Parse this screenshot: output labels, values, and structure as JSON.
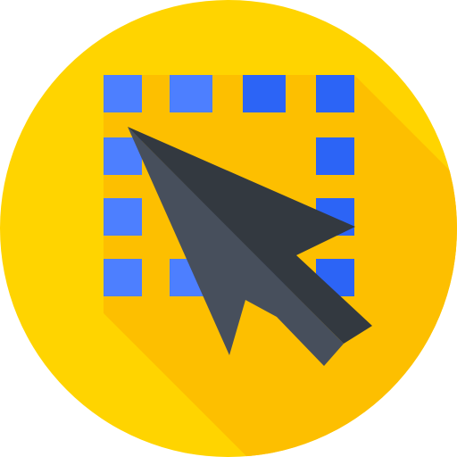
{
  "icon": {
    "name": "selection-cursor-icon",
    "colors": {
      "background_circle": "#FFD400",
      "long_shadow": "#FDBF00",
      "selection_square_light": "#4D7FFF",
      "selection_square_dark": "#2C64F6",
      "cursor_light": "#474F5C",
      "cursor_dark": "#333940"
    },
    "selection_grid": {
      "rows": 4,
      "columns": 4,
      "style": "dashed outline of small squares"
    }
  }
}
